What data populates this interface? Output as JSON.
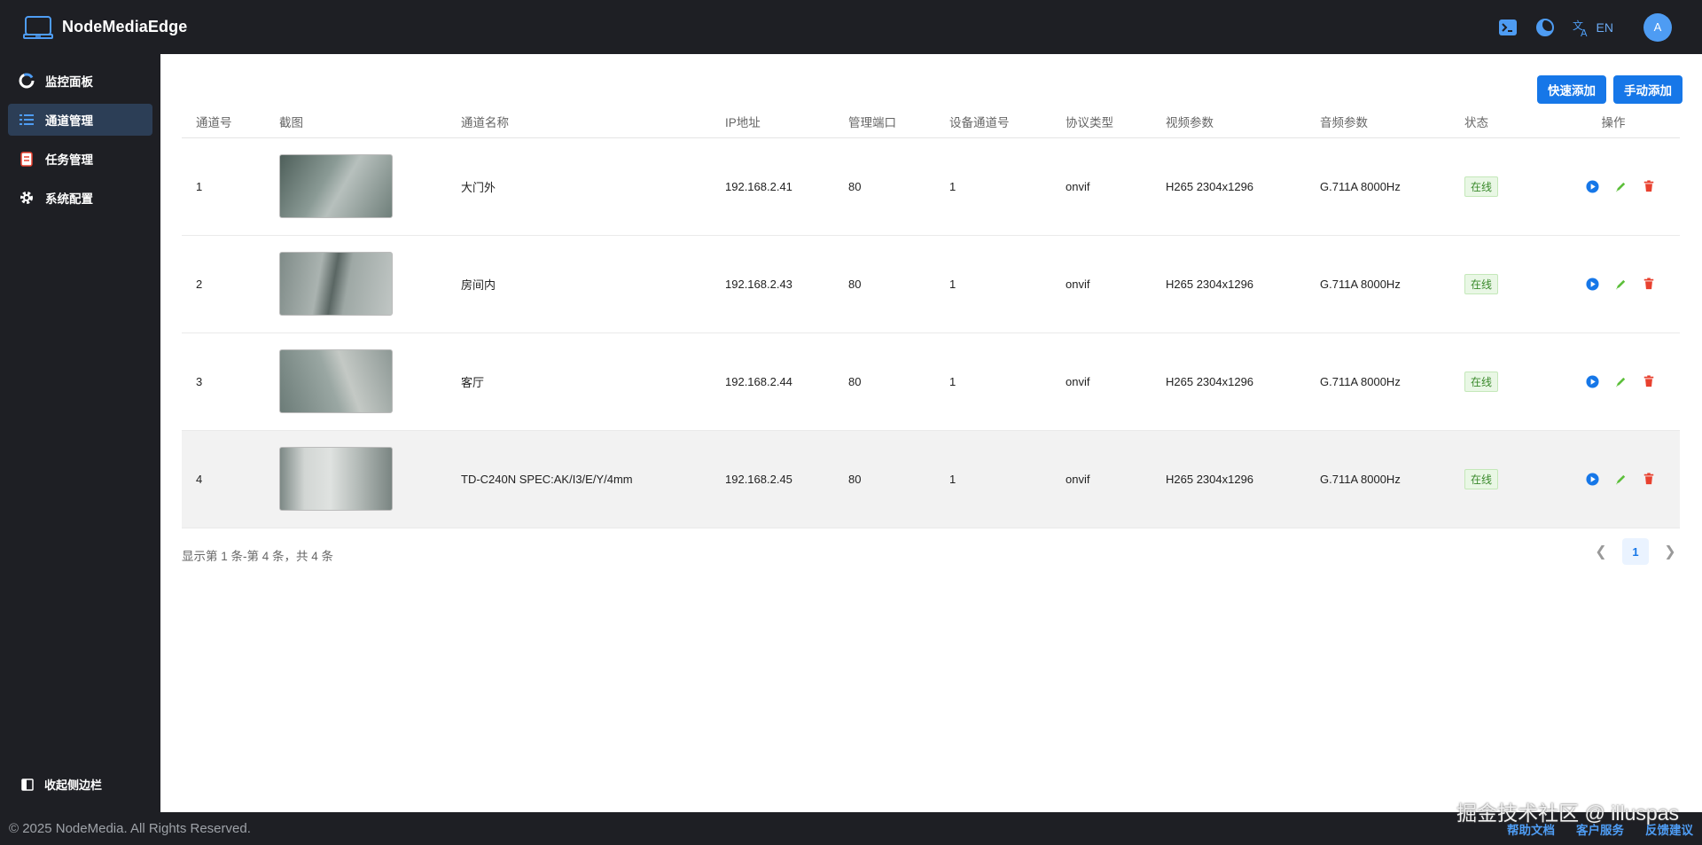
{
  "app": {
    "title": "NodeMediaEdge"
  },
  "header": {
    "lang_label": "EN",
    "avatar_initial": "A"
  },
  "sidebar": {
    "items": [
      {
        "label": "监控面板",
        "icon": "dashboard-icon"
      },
      {
        "label": "通道管理",
        "icon": "list-icon",
        "active": true
      },
      {
        "label": "任务管理",
        "icon": "clipboard-icon"
      },
      {
        "label": "系统配置",
        "icon": "gear-icon"
      }
    ],
    "collapse_label": "收起侧边栏"
  },
  "toolbar": {
    "quick_add": "快速添加",
    "manual_add": "手动添加"
  },
  "table": {
    "columns": [
      "通道号",
      "截图",
      "通道名称",
      "IP地址",
      "管理端口",
      "设备通道号",
      "协议类型",
      "视频参数",
      "音频参数",
      "状态",
      "操作"
    ],
    "rows": [
      {
        "id": "1",
        "name": "大门外",
        "ip": "192.168.2.41",
        "port": "80",
        "device_channel": "1",
        "protocol": "onvif",
        "video": "H265 2304x1296",
        "audio": "G.711A 8000Hz",
        "status": "在线"
      },
      {
        "id": "2",
        "name": "房间内",
        "ip": "192.168.2.43",
        "port": "80",
        "device_channel": "1",
        "protocol": "onvif",
        "video": "H265 2304x1296",
        "audio": "G.711A 8000Hz",
        "status": "在线"
      },
      {
        "id": "3",
        "name": "客厅",
        "ip": "192.168.2.44",
        "port": "80",
        "device_channel": "1",
        "protocol": "onvif",
        "video": "H265 2304x1296",
        "audio": "G.711A 8000Hz",
        "status": "在线"
      },
      {
        "id": "4",
        "name": "TD-C240N SPEC:AK/I3/E/Y/4mm",
        "ip": "192.168.2.45",
        "port": "80",
        "device_channel": "1",
        "protocol": "onvif",
        "video": "H265 2304x1296",
        "audio": "G.711A 8000Hz",
        "status": "在线"
      }
    ]
  },
  "pagination": {
    "summary": "显示第 1 条-第 4 条，共 4 条",
    "current_page": "1"
  },
  "footer": {
    "copyright": "© 2025 NodeMedia. All Rights Reserved.",
    "links": [
      "帮助文档",
      "客户服务",
      "反馈建议"
    ],
    "watermark": "掘金技术社区 @ illuspas"
  },
  "colors": {
    "accent": "#1677e8",
    "dark_bg": "#1e1f24",
    "online": "#3a8a2c",
    "delete": "#e8412f",
    "edit": "#5cbf3a"
  }
}
